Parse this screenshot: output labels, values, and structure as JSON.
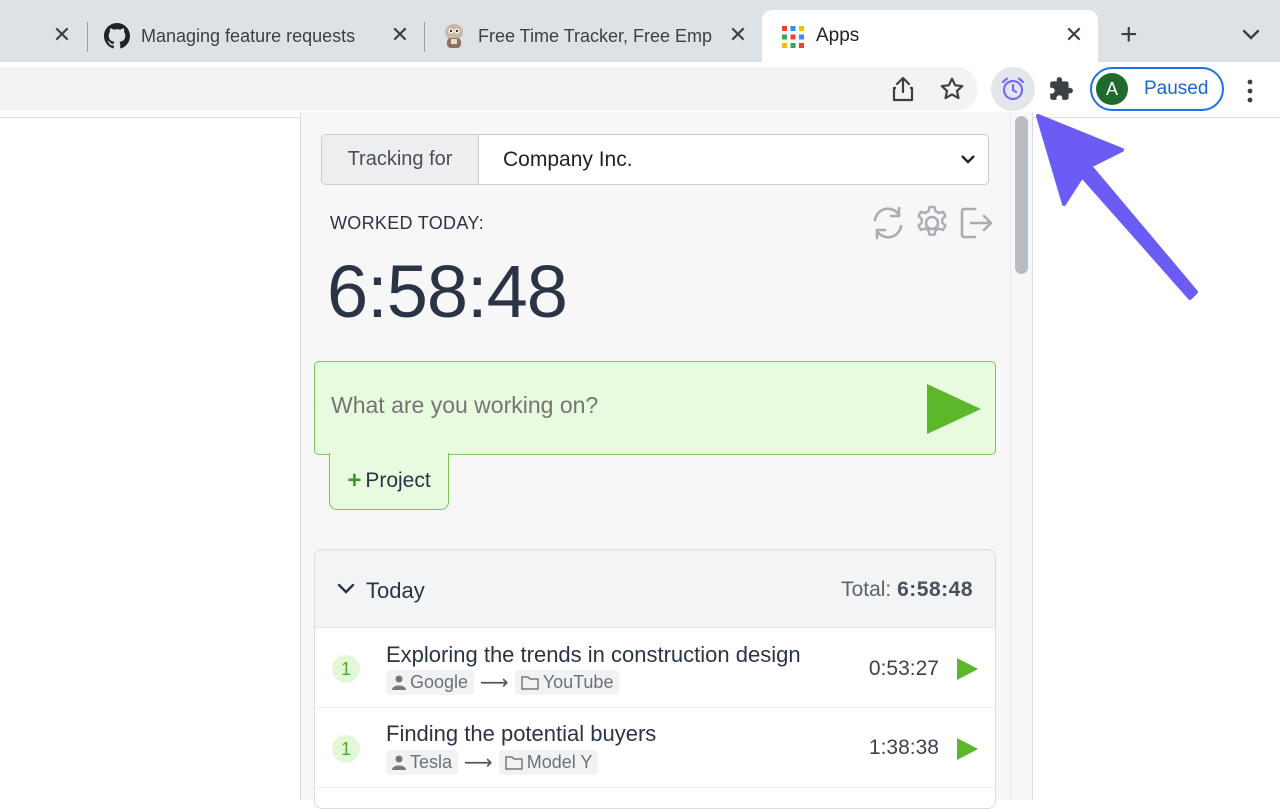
{
  "tabs": [
    {
      "title": "Managing feature requests",
      "icon": "github-icon"
    },
    {
      "title": "Free Time Tracker, Free Emp",
      "icon": "tracker-mascot-icon"
    },
    {
      "title": "Apps",
      "icon": "apps-grid-icon",
      "active": true
    }
  ],
  "toolbar": {
    "profile_initial": "A",
    "profile_label": "Paused"
  },
  "popup": {
    "tracking_label": "Tracking for",
    "tracking_value": "Company Inc.",
    "worked_label": "WORKED TODAY:",
    "timer": "6:58:48",
    "entry_placeholder": "What are you working on?",
    "project_label": "Project",
    "day": {
      "title": "Today",
      "total_label": "Total:",
      "total_value": "6:58:48",
      "entries": [
        {
          "count": "1",
          "description": "Exploring the trends in construction design",
          "client": "Google",
          "project": "YouTube",
          "duration": "0:53:27"
        },
        {
          "count": "1",
          "description": "Finding the potential buyers",
          "client": "Tesla",
          "project": "Model Y",
          "duration": "1:38:38"
        }
      ]
    }
  },
  "colors": {
    "accent_green": "#5cb82a",
    "entry_bg": "#e9fbdf",
    "pointer_arrow": "#6b5cf6",
    "profile_blue": "#1a73e8"
  }
}
